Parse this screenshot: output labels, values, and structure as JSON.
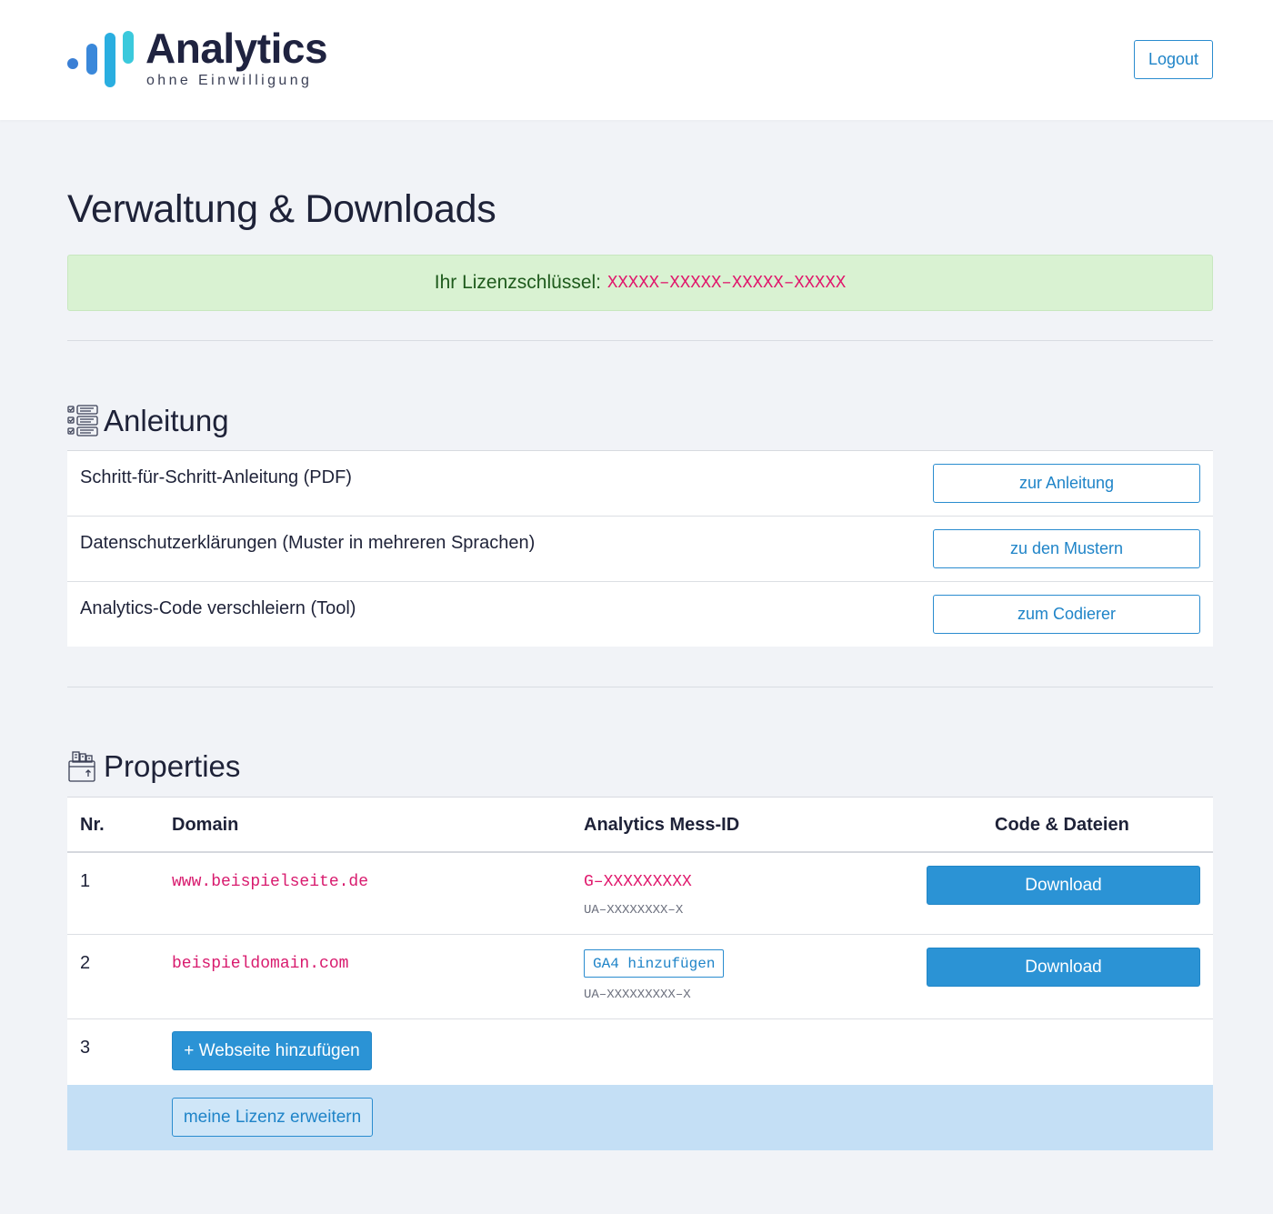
{
  "header": {
    "logo_title": "Analytics",
    "logo_subtitle": "ohne Einwilligung",
    "logout_label": "Logout"
  },
  "page": {
    "title": "Verwaltung & Downloads"
  },
  "license": {
    "label": "Ihr Lizenzschlüssel:",
    "key": "XXXXX–XXXXX–XXXXX–XXXXX"
  },
  "guide": {
    "title": "Anleitung",
    "icon": "checklist-icon",
    "rows": [
      {
        "label": "Schritt-für-Schritt-Anleitung (PDF)",
        "button": "zur Anleitung"
      },
      {
        "label": "Datenschutzerklärungen (Muster in mehreren Sprachen)",
        "button": "zu den Mustern"
      },
      {
        "label": "Analytics-Code verschleiern (Tool)",
        "button": "zum Codierer"
      }
    ]
  },
  "properties": {
    "title": "Properties",
    "icon": "archive-box-icon",
    "columns": [
      "Nr.",
      "Domain",
      "Analytics Mess-ID",
      "Code & Dateien"
    ],
    "rows": [
      {
        "nr": "1",
        "domain": "www.beispielseite.de",
        "measurement_id": "G–XXXXXXXXX",
        "ua_id": "UA–XXXXXXXX–X",
        "download": "Download"
      },
      {
        "nr": "2",
        "domain": "beispieldomain.com",
        "ga4_button": "GA4 hinzufügen",
        "ua_id": "UA–XXXXXXXXX–X",
        "download": "Download"
      }
    ],
    "add_row": {
      "nr": "3",
      "button": "+ Webseite hinzufügen"
    },
    "extend_button": "meine Lizenz erweitern"
  },
  "colors": {
    "accent": "#2b93d5",
    "key_pink": "#e0186c",
    "license_bg": "#d9f2d2",
    "footer_row_bg": "#c4dff5",
    "page_bg": "#f1f3f7"
  }
}
